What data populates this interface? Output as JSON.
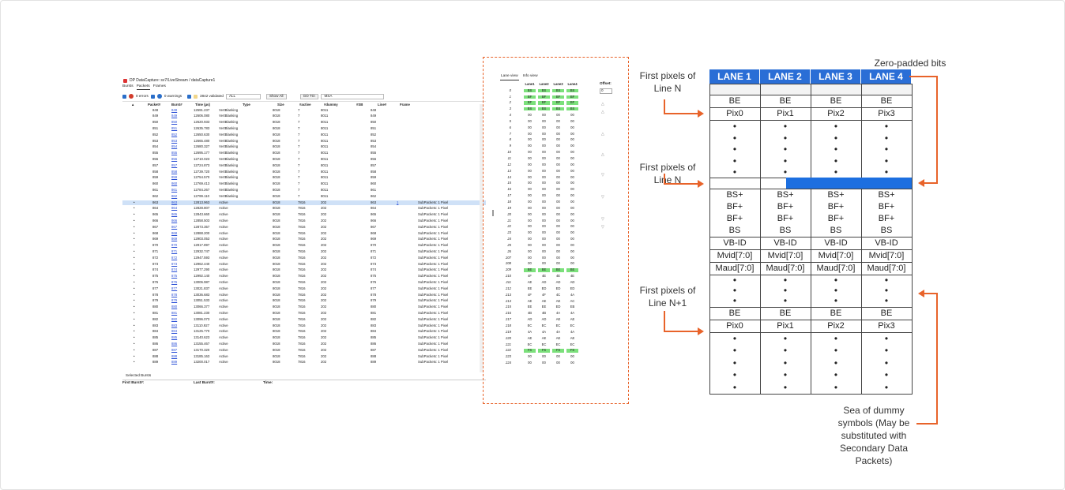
{
  "window": {
    "title": "DP DataCapture: sv7/LiveStream / dataCapture1",
    "menu": [
      "Bursts",
      "Packets",
      "Frames"
    ],
    "toolbar": {
      "errors": "0 errors",
      "warnings": "0 warnings",
      "validated": "3842 validated",
      "filter": "ALL",
      "show_all": "Show All",
      "goto": "GO TO:",
      "goto_value": "MSA"
    },
    "columns": [
      "Packet#",
      "Burst#",
      "Time (µs)",
      "Type",
      "Size",
      "#active",
      "#dummy",
      "#SB",
      "Line#",
      "Frame"
    ],
    "rows": [
      {
        "p": "848",
        "b": "848",
        "t": "12591.237",
        "type": "VertBlanking",
        "s": "8018",
        "a": "7",
        "d": "8011",
        "l": "848",
        "f": "",
        "x": ""
      },
      {
        "p": "849",
        "b": "849",
        "t": "12606.080",
        "type": "VertBlanking",
        "s": "8018",
        "a": "7",
        "d": "8011",
        "l": "849",
        "f": "",
        "x": ""
      },
      {
        "p": "850",
        "b": "850",
        "t": "12620.933",
        "type": "VertBlanking",
        "s": "8018",
        "a": "7",
        "d": "8011",
        "l": "850",
        "f": "",
        "x": ""
      },
      {
        "p": "851",
        "b": "851",
        "t": "12635.783",
        "type": "VertBlanking",
        "s": "8018",
        "a": "7",
        "d": "8011",
        "l": "851",
        "f": "",
        "x": ""
      },
      {
        "p": "852",
        "b": "852",
        "t": "12650.630",
        "type": "VertBlanking",
        "s": "8018",
        "a": "7",
        "d": "8011",
        "l": "852",
        "f": "",
        "x": ""
      },
      {
        "p": "853",
        "b": "853",
        "t": "12665.480",
        "type": "VertBlanking",
        "s": "8018",
        "a": "7",
        "d": "8011",
        "l": "853",
        "f": "",
        "x": ""
      },
      {
        "p": "854",
        "b": "854",
        "t": "12680.327",
        "type": "VertBlanking",
        "s": "8018",
        "a": "7",
        "d": "8011",
        "l": "854",
        "f": "",
        "x": ""
      },
      {
        "p": "855",
        "b": "855",
        "t": "12695.177",
        "type": "VertBlanking",
        "s": "8018",
        "a": "7",
        "d": "8011",
        "l": "855",
        "f": "",
        "x": ""
      },
      {
        "p": "856",
        "b": "856",
        "t": "12710.023",
        "type": "VertBlanking",
        "s": "8018",
        "a": "7",
        "d": "8011",
        "l": "856",
        "f": "",
        "x": ""
      },
      {
        "p": "857",
        "b": "857",
        "t": "12724.873",
        "type": "VertBlanking",
        "s": "8018",
        "a": "7",
        "d": "8011",
        "l": "857",
        "f": "",
        "x": ""
      },
      {
        "p": "858",
        "b": "858",
        "t": "12739.720",
        "type": "VertBlanking",
        "s": "8018",
        "a": "7",
        "d": "8011",
        "l": "858",
        "f": "",
        "x": ""
      },
      {
        "p": "859",
        "b": "859",
        "t": "12754.570",
        "type": "VertBlanking",
        "s": "8018",
        "a": "7",
        "d": "8011",
        "l": "859",
        "f": "",
        "x": ""
      },
      {
        "p": "860",
        "b": "860",
        "t": "12769.413",
        "type": "VertBlanking",
        "s": "8018",
        "a": "7",
        "d": "8011",
        "l": "860",
        "f": "",
        "x": ""
      },
      {
        "p": "861",
        "b": "861",
        "t": "12784.267",
        "type": "VertBlanking",
        "s": "8018",
        "a": "7",
        "d": "8011",
        "l": "861",
        "f": "",
        "x": ""
      },
      {
        "p": "862",
        "b": "862",
        "t": "12799.110",
        "type": "VertBlanking",
        "s": "8018",
        "a": "7",
        "d": "8011",
        "l": "862",
        "f": "",
        "x": ""
      },
      {
        "p": "863",
        "b": "863",
        "t": "12813.963",
        "type": "Active",
        "s": "8018",
        "a": "7816",
        "d": "202",
        "l": "863",
        "f": "1",
        "x": "SubPackets: 1 Pixel",
        "hl": true
      },
      {
        "p": "864",
        "b": "864",
        "t": "12828.807",
        "type": "Active",
        "s": "8018",
        "a": "7816",
        "d": "202",
        "l": "864",
        "f": "",
        "x": "SubPackets: 1 Pixel"
      },
      {
        "p": "865",
        "b": "865",
        "t": "12843.660",
        "type": "Active",
        "s": "8018",
        "a": "7816",
        "d": "202",
        "l": "865",
        "f": "",
        "x": "SubPackets: 1 Pixel"
      },
      {
        "p": "866",
        "b": "866",
        "t": "12858.503",
        "type": "Active",
        "s": "8018",
        "a": "7816",
        "d": "202",
        "l": "866",
        "f": "",
        "x": "SubPackets: 1 Pixel"
      },
      {
        "p": "867",
        "b": "867",
        "t": "12873.357",
        "type": "Active",
        "s": "8018",
        "a": "7816",
        "d": "202",
        "l": "867",
        "f": "",
        "x": "SubPackets: 1 Pixel"
      },
      {
        "p": "868",
        "b": "868",
        "t": "12888.200",
        "type": "Active",
        "s": "8018",
        "a": "7816",
        "d": "202",
        "l": "868",
        "f": "",
        "x": "SubPackets: 1 Pixel"
      },
      {
        "p": "869",
        "b": "869",
        "t": "12903.053",
        "type": "Active",
        "s": "8018",
        "a": "7816",
        "d": "202",
        "l": "869",
        "f": "",
        "x": "SubPackets: 1 Pixel"
      },
      {
        "p": "870",
        "b": "870",
        "t": "12917.897",
        "type": "Active",
        "s": "8018",
        "a": "7816",
        "d": "202",
        "l": "870",
        "f": "",
        "x": "SubPackets: 1 Pixel"
      },
      {
        "p": "871",
        "b": "871",
        "t": "12932.747",
        "type": "Active",
        "s": "8018",
        "a": "7816",
        "d": "202",
        "l": "871",
        "f": "",
        "x": "SubPackets: 1 Pixel"
      },
      {
        "p": "872",
        "b": "872",
        "t": "12947.593",
        "type": "Active",
        "s": "8018",
        "a": "7816",
        "d": "202",
        "l": "872",
        "f": "",
        "x": "SubPackets: 1 Pixel"
      },
      {
        "p": "873",
        "b": "873",
        "t": "12962.440",
        "type": "Active",
        "s": "8018",
        "a": "7816",
        "d": "202",
        "l": "873",
        "f": "",
        "x": "SubPackets: 1 Pixel"
      },
      {
        "p": "874",
        "b": "874",
        "t": "12977.290",
        "type": "Active",
        "s": "8018",
        "a": "7816",
        "d": "202",
        "l": "874",
        "f": "",
        "x": "SubPackets: 1 Pixel"
      },
      {
        "p": "875",
        "b": "875",
        "t": "12992.140",
        "type": "Active",
        "s": "8018",
        "a": "7816",
        "d": "202",
        "l": "875",
        "f": "",
        "x": "SubPackets: 1 Pixel"
      },
      {
        "p": "876",
        "b": "876",
        "t": "13006.987",
        "type": "Active",
        "s": "8018",
        "a": "7816",
        "d": "202",
        "l": "876",
        "f": "",
        "x": "SubPackets: 1 Pixel"
      },
      {
        "p": "877",
        "b": "877",
        "t": "13021.837",
        "type": "Active",
        "s": "8018",
        "a": "7816",
        "d": "202",
        "l": "877",
        "f": "",
        "x": "SubPackets: 1 Pixel"
      },
      {
        "p": "878",
        "b": "878",
        "t": "13036.683",
        "type": "Active",
        "s": "8018",
        "a": "7816",
        "d": "202",
        "l": "878",
        "f": "",
        "x": "SubPackets: 1 Pixel"
      },
      {
        "p": "879",
        "b": "879",
        "t": "13051.533",
        "type": "Active",
        "s": "8018",
        "a": "7816",
        "d": "202",
        "l": "879",
        "f": "",
        "x": "SubPackets: 1 Pixel"
      },
      {
        "p": "880",
        "b": "880",
        "t": "13066.377",
        "type": "Active",
        "s": "8018",
        "a": "7816",
        "d": "202",
        "l": "880",
        "f": "",
        "x": "SubPackets: 1 Pixel"
      },
      {
        "p": "881",
        "b": "881",
        "t": "13081.230",
        "type": "Active",
        "s": "8018",
        "a": "7816",
        "d": "202",
        "l": "881",
        "f": "",
        "x": "SubPackets: 1 Pixel"
      },
      {
        "p": "882",
        "b": "882",
        "t": "13096.073",
        "type": "Active",
        "s": "8018",
        "a": "7816",
        "d": "202",
        "l": "882",
        "f": "",
        "x": "SubPackets: 1 Pixel"
      },
      {
        "p": "883",
        "b": "883",
        "t": "13110.927",
        "type": "Active",
        "s": "8018",
        "a": "7816",
        "d": "202",
        "l": "883",
        "f": "",
        "x": "SubPackets: 1 Pixel"
      },
      {
        "p": "884",
        "b": "884",
        "t": "13125.770",
        "type": "Active",
        "s": "8018",
        "a": "7816",
        "d": "202",
        "l": "884",
        "f": "",
        "x": "SubPackets: 1 Pixel"
      },
      {
        "p": "885",
        "b": "885",
        "t": "13140.623",
        "type": "Active",
        "s": "8018",
        "a": "7816",
        "d": "202",
        "l": "885",
        "f": "",
        "x": "SubPackets: 1 Pixel"
      },
      {
        "p": "886",
        "b": "886",
        "t": "13155.467",
        "type": "Active",
        "s": "8018",
        "a": "7816",
        "d": "202",
        "l": "886",
        "f": "",
        "x": "SubPackets: 1 Pixel"
      },
      {
        "p": "887",
        "b": "887",
        "t": "13170.320",
        "type": "Active",
        "s": "8018",
        "a": "7816",
        "d": "202",
        "l": "887",
        "f": "",
        "x": "SubPackets: 1 Pixel"
      },
      {
        "p": "888",
        "b": "888",
        "t": "13185.163",
        "type": "Active",
        "s": "8018",
        "a": "7816",
        "d": "202",
        "l": "888",
        "f": "",
        "x": "SubPackets: 1 Pixel"
      },
      {
        "p": "889",
        "b": "889",
        "t": "13200.017",
        "type": "Active",
        "s": "8018",
        "a": "7816",
        "d": "202",
        "l": "889",
        "f": "",
        "x": "SubPackets: 1 Pixel"
      }
    ],
    "footer": {
      "selected": "Selected Bursts",
      "first": "First Burst#:",
      "last": "Last Burst#:",
      "time": "Time:"
    }
  },
  "lane_view": {
    "tabs": [
      "Lane view",
      "Info view"
    ],
    "headers": [
      "Lane1",
      "Lane2",
      "Lane3",
      "Lane4"
    ],
    "offset_label": "Offset:",
    "offset_value": "0",
    "rows": [
      {
        "i": "0",
        "v": [
          "BS",
          "BS",
          "BS",
          "BS"
        ],
        "g": true
      },
      {
        "i": "1",
        "v": [
          "BF",
          "BF",
          "BF",
          "BF"
        ],
        "g": true
      },
      {
        "i": "2",
        "v": [
          "BF",
          "BF",
          "BF",
          "BF"
        ],
        "g": true
      },
      {
        "i": "3",
        "v": [
          "BS",
          "BS",
          "BS",
          "BS"
        ],
        "g": true
      },
      {
        "i": "4",
        "v": [
          "00",
          "00",
          "00",
          "00"
        ]
      },
      {
        "i": "5",
        "v": [
          "00",
          "00",
          "00",
          "00"
        ]
      },
      {
        "i": "6",
        "v": [
          "00",
          "00",
          "00",
          "00"
        ]
      },
      {
        "i": "7",
        "v": [
          "00",
          "00",
          "00",
          "00"
        ]
      },
      {
        "i": "8",
        "v": [
          "00",
          "00",
          "00",
          "00"
        ]
      },
      {
        "i": "9",
        "v": [
          "00",
          "00",
          "00",
          "00"
        ]
      },
      {
        "i": "10",
        "v": [
          "00",
          "00",
          "00",
          "00"
        ]
      },
      {
        "i": "11",
        "v": [
          "00",
          "00",
          "00",
          "00"
        ]
      },
      {
        "i": "12",
        "v": [
          "00",
          "00",
          "00",
          "00"
        ]
      },
      {
        "i": "13",
        "v": [
          "00",
          "00",
          "00",
          "00"
        ]
      },
      {
        "i": "14",
        "v": [
          "00",
          "00",
          "00",
          "00"
        ]
      },
      {
        "i": "15",
        "v": [
          "00",
          "00",
          "00",
          "00"
        ]
      },
      {
        "i": "16",
        "v": [
          "00",
          "00",
          "00",
          "00"
        ]
      },
      {
        "i": "17",
        "v": [
          "00",
          "00",
          "00",
          "00"
        ]
      },
      {
        "i": "18",
        "v": [
          "00",
          "00",
          "00",
          "00"
        ]
      },
      {
        "i": "19",
        "v": [
          "00",
          "00",
          "00",
          "00"
        ]
      },
      {
        "i": "20",
        "v": [
          "00",
          "00",
          "00",
          "00"
        ]
      },
      {
        "i": "21",
        "v": [
          "00",
          "00",
          "00",
          "00"
        ]
      },
      {
        "i": "22",
        "v": [
          "00",
          "00",
          "00",
          "00"
        ]
      },
      {
        "i": "23",
        "v": [
          "00",
          "00",
          "00",
          "00"
        ]
      },
      {
        "i": "24",
        "v": [
          "00",
          "00",
          "00",
          "00"
        ]
      },
      {
        "i": "25",
        "v": [
          "00",
          "00",
          "00",
          "00"
        ]
      },
      {
        "i": "26",
        "v": [
          "00",
          "00",
          "00",
          "00"
        ]
      },
      {
        "i": "207",
        "v": [
          "00",
          "00",
          "00",
          "00"
        ]
      },
      {
        "i": "208",
        "v": [
          "00",
          "00",
          "00",
          "00"
        ]
      },
      {
        "i": "209",
        "v": [
          "BE",
          "BE",
          "BE",
          "BE"
        ],
        "g": true
      },
      {
        "i": "210",
        "v": [
          "4F",
          "4E",
          "4E",
          "4E"
        ]
      },
      {
        "i": "211",
        "v": [
          "AE",
          "AD",
          "AD",
          "AD"
        ]
      },
      {
        "i": "212",
        "v": [
          "EE",
          "ED",
          "ED",
          "ED"
        ]
      },
      {
        "i": "213",
        "v": [
          "4F",
          "4F",
          "4C",
          "4A"
        ]
      },
      {
        "i": "214",
        "v": [
          "AE",
          "AE",
          "AE",
          "AC"
        ]
      },
      {
        "i": "215",
        "v": [
          "EE",
          "EE",
          "ED",
          "EB"
        ]
      },
      {
        "i": "216",
        "v": [
          "4B",
          "4B",
          "4A",
          "4A"
        ]
      },
      {
        "i": "217",
        "v": [
          "AD",
          "AD",
          "AE",
          "AE"
        ]
      },
      {
        "i": "218",
        "v": [
          "EC",
          "EC",
          "EC",
          "EC"
        ]
      },
      {
        "i": "219",
        "v": [
          "4A",
          "4A",
          "4A",
          "4A"
        ]
      },
      {
        "i": "220",
        "v": [
          "AE",
          "AE",
          "AE",
          "AE"
        ]
      },
      {
        "i": "221",
        "v": [
          "EC",
          "EC",
          "EC",
          "EC"
        ]
      },
      {
        "i": "222",
        "v": [
          "FS",
          "FS",
          "FS",
          "FS"
        ],
        "g": true
      },
      {
        "i": "223",
        "v": [
          "00",
          "00",
          "00",
          "00"
        ]
      },
      {
        "i": "224",
        "v": [
          "00",
          "00",
          "00",
          "00"
        ]
      }
    ]
  },
  "diagram": {
    "lanes": [
      "LANE 1",
      "LANE 2",
      "LANE 3",
      "LANE 4"
    ],
    "block1": [
      [
        "BE",
        "BE",
        "BE",
        "BE"
      ],
      [
        "Pix0",
        "Pix1",
        "Pix2",
        "Pix3"
      ]
    ],
    "bs_rows": [
      [
        "BS+",
        "BS+",
        "BS+",
        "BS+"
      ],
      [
        "BF+",
        "BF+",
        "BF+",
        "BF+"
      ],
      [
        "BF+",
        "BF+",
        "BF+",
        "BF+"
      ],
      [
        "BS",
        "BS",
        "BS",
        "BS"
      ]
    ],
    "vb_rows": [
      [
        "VB-ID",
        "VB-ID",
        "VB-ID",
        "VB-ID"
      ],
      [
        "Mvid[7:0]",
        "Mvid[7:0]",
        "Mvid[7:0]",
        "Mvid[7:0]"
      ],
      [
        "Maud[7:0]",
        "Maud[7:0]",
        "Maud[7:0]",
        "Maud[7:0]"
      ]
    ],
    "block2": [
      [
        "BE",
        "BE",
        "BE",
        "BE"
      ],
      [
        "Pix0",
        "Pix1",
        "Pix2",
        "Pix3"
      ]
    ],
    "dot": "•",
    "labels": {
      "zero_padded": "Zero-padded bits",
      "first_n_1": "First pixels of Line N",
      "first_n_2": "First pixels of Line N",
      "first_n1": "First pixels of Line N+1",
      "sea": "Sea of dummy symbols (May be substituted with Secondary Data Packets)"
    },
    "colors": {
      "lane_header": "#2a6ed6",
      "accent": "#e8632a",
      "pad": "#1d6fe0",
      "green": "#7be07b"
    }
  }
}
